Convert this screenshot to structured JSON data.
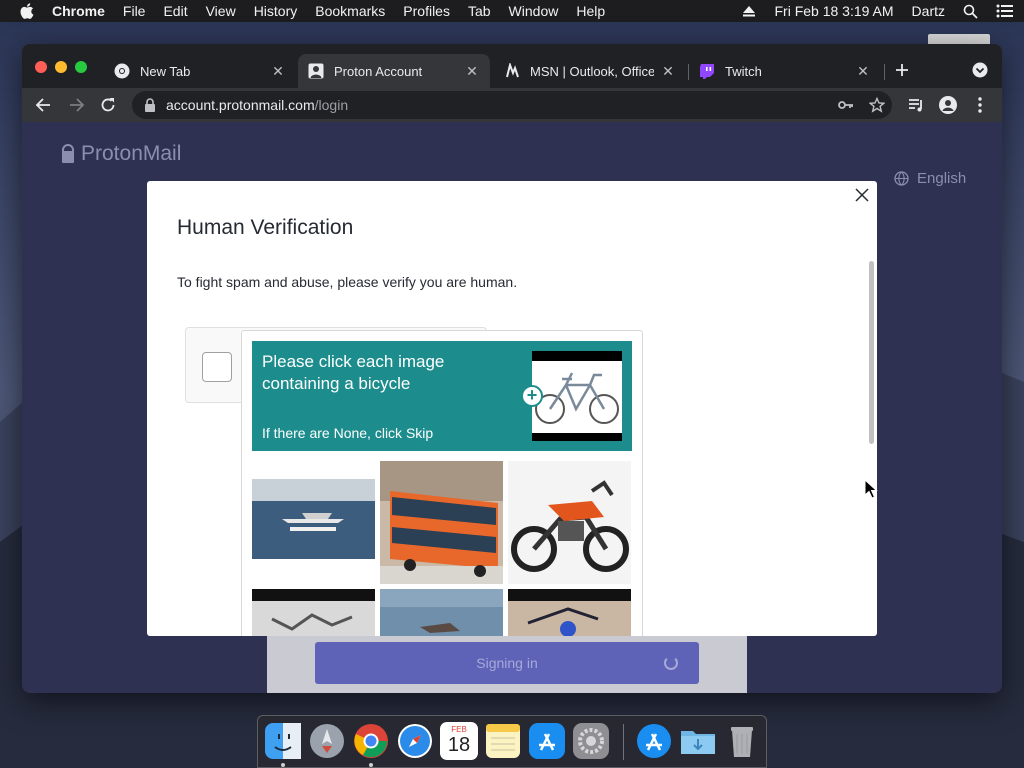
{
  "menubar": {
    "app_name": "Chrome",
    "items": [
      "File",
      "Edit",
      "View",
      "History",
      "Bookmarks",
      "Profiles",
      "Tab",
      "Window",
      "Help"
    ],
    "datetime": "Fri Feb 18  3:19 AM",
    "user": "Dartz"
  },
  "browser": {
    "tabs": [
      {
        "label": "New Tab",
        "icon": "chrome-icon",
        "active": false
      },
      {
        "label": "Proton Account",
        "icon": "account-icon",
        "active": true
      },
      {
        "label": "MSN | Outlook, Office, S",
        "icon": "msn-icon",
        "active": false
      },
      {
        "label": "Twitch",
        "icon": "twitch-icon",
        "active": false
      }
    ],
    "url_host": "account.protonmail.com",
    "url_path": "/login"
  },
  "page": {
    "logo_text": "ProtonMail",
    "language": "English",
    "signin_label": "Signing in"
  },
  "modal": {
    "title": "Human Verification",
    "description": "To fight spam and abuse, please verify you are human.",
    "captcha": {
      "prompt": "Please click each image containing a bicycle",
      "subprompt": "If there are None, click Skip",
      "tiles": [
        "seaplane",
        "bus",
        "motorcycle",
        "partial-1",
        "partial-2",
        "partial-3"
      ]
    }
  },
  "dock": {
    "apps": [
      "finder-icon",
      "launchpad-icon",
      "chrome-icon",
      "safari-icon",
      "calendar-icon",
      "notes-icon",
      "app-store-icon",
      "system-preferences-icon",
      "app-store-download-icon",
      "downloads-folder-icon",
      "trash-icon"
    ],
    "calendar_month": "FEB",
    "calendar_day": "18"
  },
  "colors": {
    "captcha_teal": "#1d8c8c",
    "proton_purple": "#5f63b8",
    "page_bg": "#2e3152"
  }
}
